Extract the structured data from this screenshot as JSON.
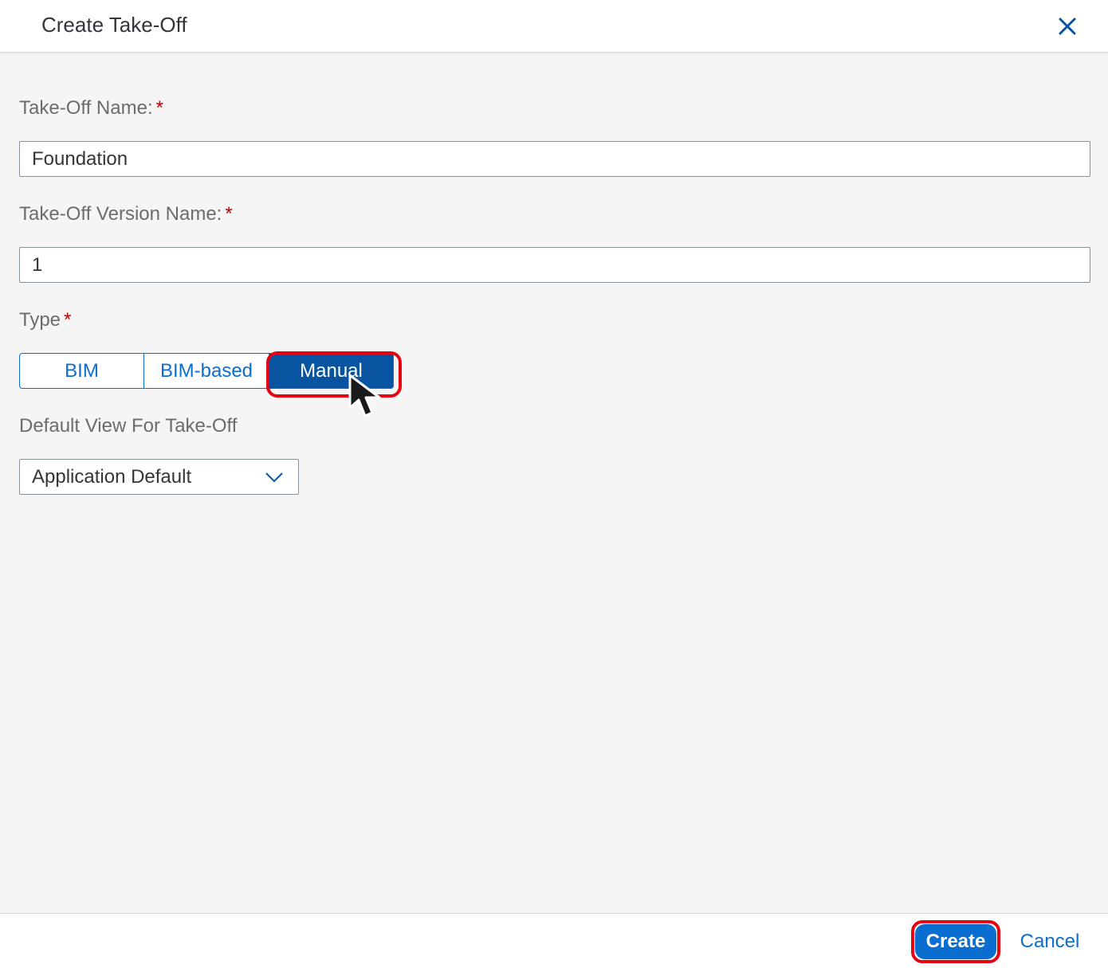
{
  "dialog": {
    "title": "Create Take-Off",
    "close_icon": "close-icon"
  },
  "form": {
    "takeoff_name": {
      "label": "Take-Off Name:",
      "required_mark": "*",
      "value": "Foundation"
    },
    "version_name": {
      "label": "Take-Off Version Name:",
      "required_mark": "*",
      "value": "1"
    },
    "type": {
      "label": "Type",
      "required_mark": "*",
      "options": [
        "BIM",
        "BIM-based",
        "Manual"
      ],
      "selected": "Manual"
    },
    "default_view": {
      "label": "Default View For Take-Off",
      "value": "Application Default",
      "icon": "chevron-down-icon"
    }
  },
  "footer": {
    "create_label": "Create",
    "cancel_label": "Cancel"
  },
  "colors": {
    "accent": "#0a6ed1",
    "selected_segment": "#0854a0",
    "required": "#bb0000",
    "highlight": "#e60012"
  },
  "cursor_icon": "mouse-pointer-icon"
}
